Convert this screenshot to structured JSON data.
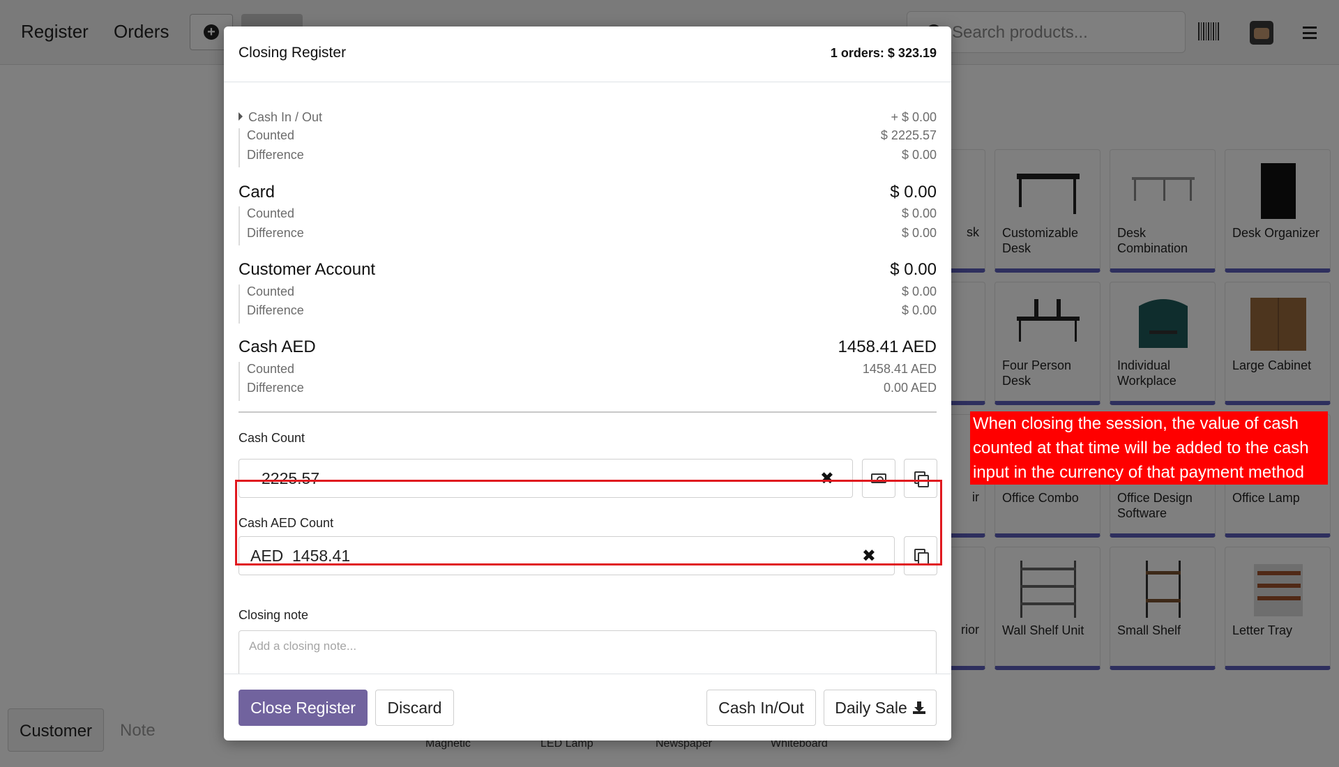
{
  "topbar": {
    "tabs": [
      "Register",
      "Orders"
    ],
    "search_placeholder": "Search products..."
  },
  "products": [
    {
      "name": "Customizable Desk"
    },
    {
      "name": "Desk Combination"
    },
    {
      "name": "Desk Organizer"
    },
    {
      "name": "Four Person Desk"
    },
    {
      "name": "Individual Workplace"
    },
    {
      "name": "Large Cabinet"
    },
    {
      "name": "Office Combo"
    },
    {
      "name": "Office Design Software"
    },
    {
      "name": "Office Lamp"
    },
    {
      "name": "Wall Shelf Unit"
    },
    {
      "name": "Small Shelf"
    },
    {
      "name": "Letter Tray"
    }
  ],
  "partial_products": [
    "sk",
    "ir",
    "rior"
  ],
  "bottom_left": {
    "customer_label": "Customer",
    "note_label": "Note",
    "partial_names": [
      "Magnetic",
      "LED Lamp",
      "Newspaper",
      "Whiteboard"
    ]
  },
  "modal": {
    "title": "Closing Register",
    "orders_summary": "1 orders: $ 323.19",
    "cash_in_out": {
      "label": "Cash In / Out",
      "value": "+ $ 0.00"
    },
    "cash_counted": {
      "label": "Counted",
      "value": "$ 2225.57"
    },
    "cash_difference": {
      "label": "Difference",
      "value": "$ 0.00"
    },
    "payment_methods": [
      {
        "name": "Card",
        "total": "$ 0.00",
        "counted_label": "Counted",
        "counted": "$ 0.00",
        "difference_label": "Difference",
        "difference": "$ 0.00"
      },
      {
        "name": "Customer Account",
        "total": "$ 0.00",
        "counted_label": "Counted",
        "counted": "$ 0.00",
        "difference_label": "Difference",
        "difference": "$ 0.00"
      },
      {
        "name": "Cash AED",
        "total": "1458.41 AED",
        "counted_label": "Counted",
        "counted": "1458.41 AED",
        "difference_label": "Difference",
        "difference": "0.00 AED"
      }
    ],
    "cash_count": {
      "label": "Cash Count",
      "value": "2225.57"
    },
    "cash_aed_count": {
      "label": "Cash AED Count",
      "currency": "AED",
      "value": "1458.41"
    },
    "closing_note": {
      "label": "Closing note",
      "placeholder": "Add a closing note..."
    },
    "footer": {
      "close_register": "Close Register",
      "discard": "Discard",
      "cash_in_out": "Cash In/Out",
      "daily_sale": "Daily Sale"
    }
  },
  "annotation": {
    "text": "When closing the session, the value of cash counted at that time will be added to the cash input in the currency of that payment method",
    "color": "#ff0000"
  },
  "colors": {
    "primary": "#71639e",
    "product_bar": "#5d5fbd",
    "highlight": "#e0191f"
  }
}
